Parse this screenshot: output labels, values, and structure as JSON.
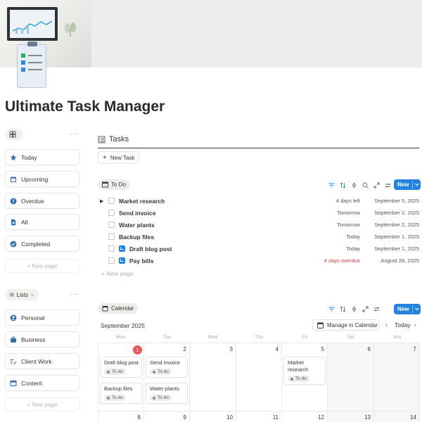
{
  "page": {
    "title": "Ultimate Task Manager"
  },
  "sidebar": {
    "views_more": "···",
    "nav": [
      {
        "label": "Today",
        "icon": "star-icon"
      },
      {
        "label": "Upcoming",
        "icon": "calendar-icon"
      },
      {
        "label": "Overdue",
        "icon": "alert-icon"
      },
      {
        "label": "All",
        "icon": "document-icon"
      },
      {
        "label": "Completed",
        "icon": "check-circle-icon"
      }
    ],
    "nav_new": "+ New page",
    "lists_label": "Lists",
    "lists_more": "···",
    "lists": [
      {
        "label": "Personal",
        "icon": "person-icon"
      },
      {
        "label": "Business",
        "icon": "briefcase-icon"
      },
      {
        "label": "Client Work",
        "icon": "pen-list-icon"
      },
      {
        "label": "Content",
        "icon": "layout-icon"
      }
    ],
    "lists_new": "+ New page"
  },
  "tasks": {
    "title": "Tasks",
    "new_task": "New Task",
    "view_label": "To Do",
    "new_button": "New",
    "rows": [
      {
        "name": "Market research",
        "due": "4 days left",
        "date": "September 5, 2025",
        "toggle": "▶"
      },
      {
        "name": "Send invoice",
        "due": "Tomorrow",
        "date": "September 2, 2025"
      },
      {
        "name": "Water plants",
        "due": "Tomorrow",
        "date": "September 2, 2025"
      },
      {
        "name": "Backup files",
        "due": "Today",
        "date": "September 1, 2025"
      },
      {
        "name": "Draft blog post",
        "due": "Today",
        "date": "September 1, 2025",
        "subtask": true
      },
      {
        "name": "Pay bills",
        "due": "4 days overdue",
        "date": "August 28, 2025",
        "subtask": true,
        "overdue": true
      }
    ],
    "add_new": "+ New page"
  },
  "calendar": {
    "view_label": "Calendar",
    "new_button": "New",
    "month": "September 2025",
    "manage": "Manage in Calendar",
    "today": "Today",
    "prev": "‹",
    "next": "›",
    "weekdays": [
      "Mon",
      "Tue",
      "Wed",
      "Thu",
      "Fri",
      "Sat",
      "Sun"
    ],
    "week1": [
      "1",
      "2",
      "3",
      "4",
      "5",
      "6",
      "7"
    ],
    "week2": [
      "8",
      "9",
      "10",
      "11",
      "12",
      "13",
      "14"
    ],
    "cards": [
      {
        "col": 0,
        "slot": 0,
        "name": "Draft blog post",
        "status": "To do"
      },
      {
        "col": 0,
        "slot": 1,
        "name": "Backup files",
        "status": "To do"
      },
      {
        "col": 1,
        "slot": 0,
        "name": "Send invoice",
        "status": "To do"
      },
      {
        "col": 1,
        "slot": 1,
        "name": "Water plants",
        "status": "To do"
      },
      {
        "col": 4,
        "slot": 0,
        "name": "Market research",
        "status": "To do"
      }
    ]
  },
  "colors": {
    "accent": "#2383e2",
    "overdue": "#e03e3e",
    "today_marker": "#eb5757"
  }
}
